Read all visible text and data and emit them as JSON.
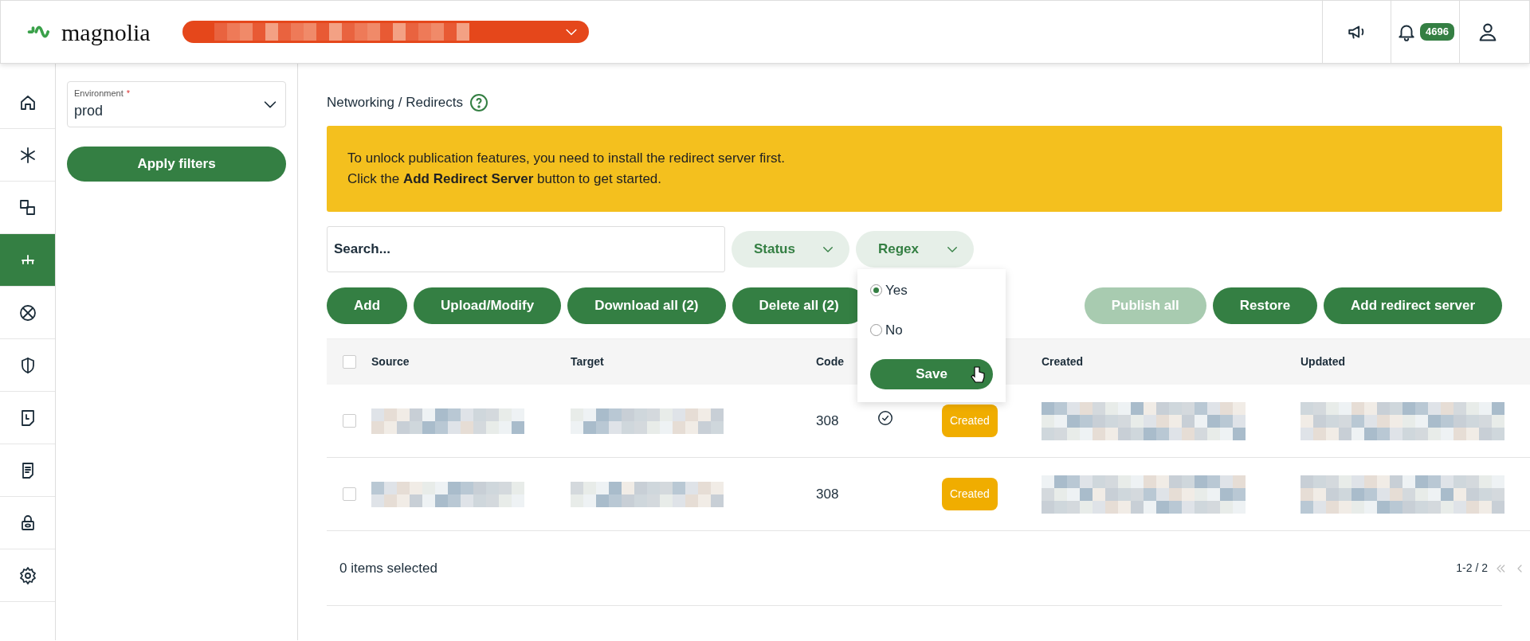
{
  "header": {
    "logo": "magnolia",
    "notification_count": "4696"
  },
  "nav": [
    {
      "kind": "home",
      "selected": false
    },
    {
      "kind": "asterisk",
      "selected": false
    },
    {
      "kind": "squares",
      "selected": false
    },
    {
      "kind": "tree",
      "selected": true
    },
    {
      "kind": "blocked",
      "selected": false
    },
    {
      "kind": "shield",
      "selected": false
    },
    {
      "kind": "clockdoc",
      "selected": false
    },
    {
      "kind": "doc",
      "selected": false
    },
    {
      "kind": "lock",
      "selected": false
    },
    {
      "kind": "gear",
      "selected": false
    }
  ],
  "filters": {
    "environment_label": "Environment",
    "required_mark": "*",
    "environment": "prod",
    "apply_button": "Apply filters"
  },
  "breadcrumb": "Networking / Redirects",
  "alert": {
    "lines": [
      "To unlock publication features, you need to install the redirect server first.",
      "Click the **Add Redirect Server** button to get started."
    ]
  },
  "search": {
    "placeholder": "Search..."
  },
  "filter_buttons": [
    "Status",
    "Regex"
  ],
  "actions_left": [
    {
      "label": "Add",
      "disabled": false
    },
    {
      "label": "Upload/Modify",
      "disabled": false
    },
    {
      "label": "Download all (2)",
      "disabled": false
    },
    {
      "label": "Delete all (2)",
      "disabled": false
    }
  ],
  "actions_right": [
    {
      "label": "Publish all",
      "disabled": true
    },
    {
      "label": "Restore",
      "disabled": false
    },
    {
      "label": "Add redirect server",
      "disabled": false
    }
  ],
  "table": {
    "all_checked": false,
    "columns": [
      "Source",
      "Target",
      "Code",
      "Created",
      "Updated"
    ],
    "rows": [
      {
        "code": "308",
        "regex": true,
        "status": "Created",
        "checked": false
      },
      {
        "code": "308",
        "regex": false,
        "status": "Created",
        "checked": false
      }
    ]
  },
  "regex_menu": {
    "options": [
      {
        "label": "Yes",
        "selected": true
      },
      {
        "label": "No",
        "selected": false
      }
    ],
    "button": "Save"
  },
  "footer": {
    "selection": "0 items selected",
    "pagination": "1-2 / 2"
  }
}
